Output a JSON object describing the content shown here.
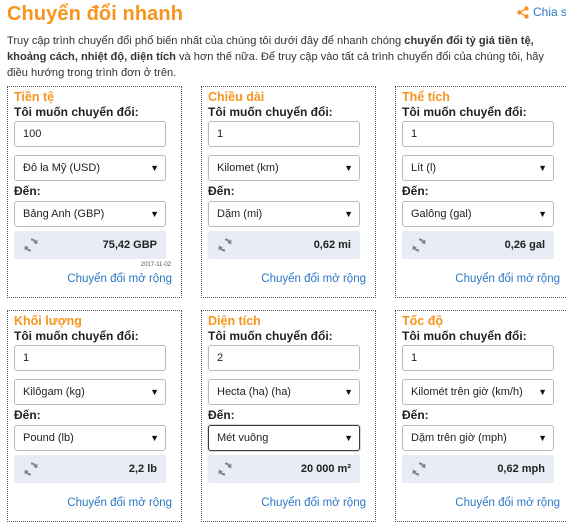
{
  "page": {
    "title": "Chuyển đổi nhanh",
    "share_label": "Chia s",
    "intro_1": "Truy cập trình chuyển đổi phổ biến nhất của chúng tôi dưới đây để nhanh chóng ",
    "intro_bold": "chuyển đổi tỷ giá tiền tệ, khoảng cách, nhiệt độ, diện tích",
    "intro_2": " và hơn thế nữa. Để truy cập vào tất cả trình chuyển đổi của chúng tôi, hãy điều hướng trong trình đơn ở trên."
  },
  "cards": [
    {
      "title": "Tiền tệ",
      "from_label": "Tôi muốn chuyển đổi:",
      "value": "100",
      "from_unit": "Đô la Mỹ (USD)",
      "to_label": "Đến:",
      "to_unit": "Bảng Anh (GBP)",
      "result": "75,42 GBP",
      "date": "2017-11-02",
      "more": "Chuyển đổi mở rộng"
    },
    {
      "title": "Chiều dài",
      "from_label": "Tôi muốn chuyển đổi:",
      "value": "1",
      "from_unit": "Kilomet (km)",
      "to_label": "Đến:",
      "to_unit": "Dặm (mi)",
      "result": "0,62 mi",
      "more": "Chuyển đổi mở rộng"
    },
    {
      "title": "Thể tích",
      "from_label": "Tôi muốn chuyển đổi:",
      "value": "1",
      "from_unit": "Lít (l)",
      "to_label": "Đến:",
      "to_unit": "Galông (gal)",
      "result": "0,26 gal",
      "more": "Chuyển đổi mở rộng"
    },
    {
      "title": "Khối lượng",
      "from_label": "Tôi muốn chuyển đổi:",
      "value": "1",
      "from_unit": "Kilôgam (kg)",
      "to_label": "Đến:",
      "to_unit": "Pound (lb)",
      "result": "2,2 lb",
      "more": "Chuyển đổi mở rộng"
    },
    {
      "title": "Diện tích",
      "from_label": "Tôi muốn chuyển đổi:",
      "value": "2",
      "from_unit": "Hecta (ha) (ha)",
      "to_label": "Đến:",
      "to_unit": "Mét vuông",
      "result": "20 000 m²",
      "more": "Chuyển đổi mở rộng"
    },
    {
      "title": "Tốc độ",
      "from_label": "Tôi muốn chuyển đổi:",
      "value": "1",
      "from_unit": "Kilomét trên giờ (km/h)",
      "to_label": "Đến:",
      "to_unit": "Dặm trên giờ (mph)",
      "result": "0,62 mph",
      "more": "Chuyển đổi mở rộng"
    }
  ],
  "icons": {
    "share": "share-icon",
    "refresh": "refresh-icon",
    "dropdown": "dropdown-arrow-icon"
  },
  "colors": {
    "accent": "#f7941d",
    "link": "#2a78c6",
    "result_bg": "#e8edf5"
  }
}
